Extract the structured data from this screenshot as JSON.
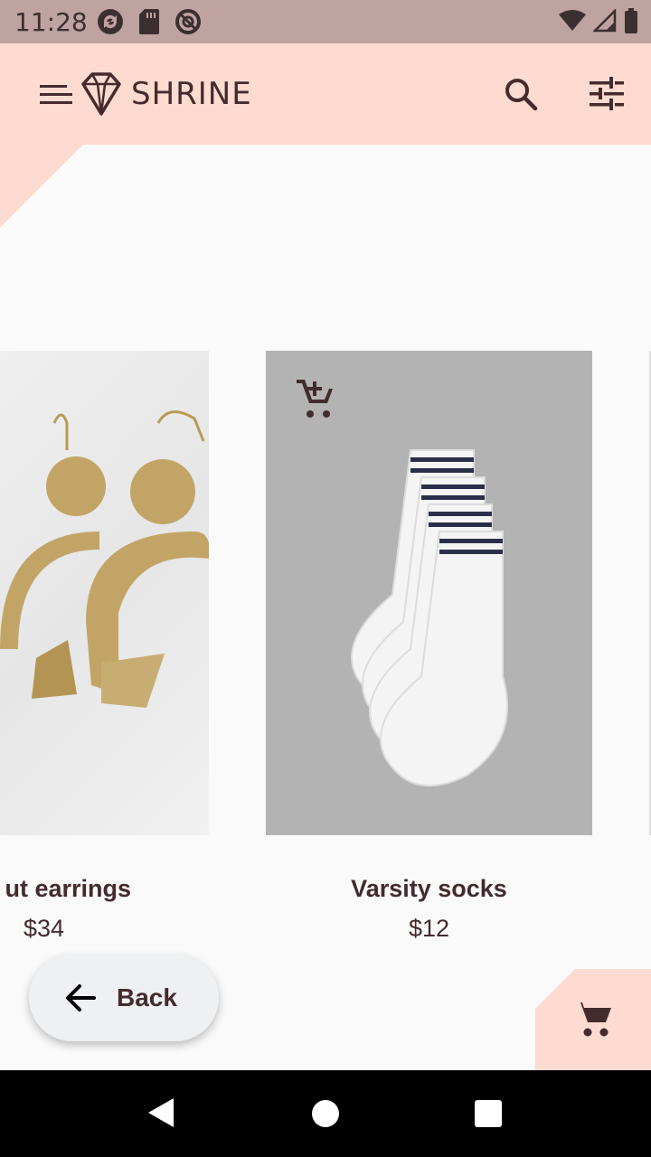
{
  "status_bar": {
    "time": "11:28",
    "left_icons": [
      "sync-icon",
      "sd-card-icon",
      "do-not-disturb-icon"
    ],
    "right_icons": [
      "wifi-icon",
      "cellular-signal-icon",
      "battery-icon"
    ]
  },
  "app_bar": {
    "title": "SHRINE",
    "icons": [
      "menu-icon",
      "diamond-logo-icon",
      "search-icon",
      "tune-icon"
    ],
    "background": "#fedbd0"
  },
  "products": [
    {
      "name": "ut earrings",
      "price": "$34"
    },
    {
      "name": "Varsity socks",
      "price": "$12",
      "action_icon": "add-shopping-cart-icon"
    }
  ],
  "back_button": {
    "label": "Back"
  },
  "cart": {
    "icon": "shopping-cart-icon"
  },
  "colors": {
    "accent": "#fedbd0",
    "text": "#442b2d",
    "status_bar": "#bfa3a0"
  }
}
